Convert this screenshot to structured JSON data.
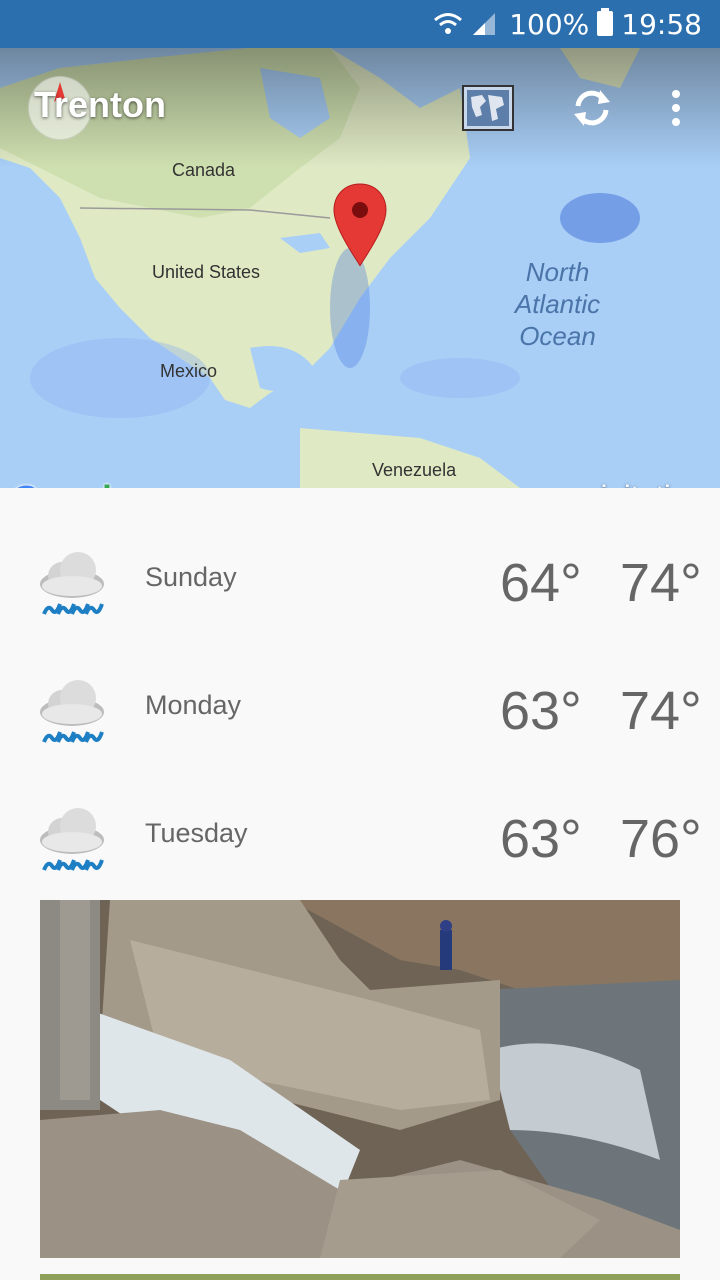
{
  "status_bar": {
    "battery": "100%",
    "time": "19:58"
  },
  "header": {
    "city": "Trenton"
  },
  "map": {
    "labels": {
      "canada": "Canada",
      "usa": "United States",
      "mexico": "Mexico",
      "venezuela": "Venezuela",
      "ocean_line1": "North",
      "ocean_line2": "Atlantic",
      "ocean_line3": "Ocean"
    },
    "google": "Google",
    "layer": "precipitation"
  },
  "forecast": [
    {
      "day": "Sunday",
      "low": "64°",
      "high": "74°",
      "icon": "rain-cloud-icon"
    },
    {
      "day": "Monday",
      "low": "63°",
      "high": "74°",
      "icon": "rain-cloud-icon"
    },
    {
      "day": "Tuesday",
      "low": "63°",
      "high": "76°",
      "icon": "rain-cloud-icon"
    }
  ],
  "colors": {
    "status_bar": "#2c6fae",
    "text_gray": "#666666",
    "pin": "#e53935",
    "rain_blue": "#1e7fc4"
  }
}
